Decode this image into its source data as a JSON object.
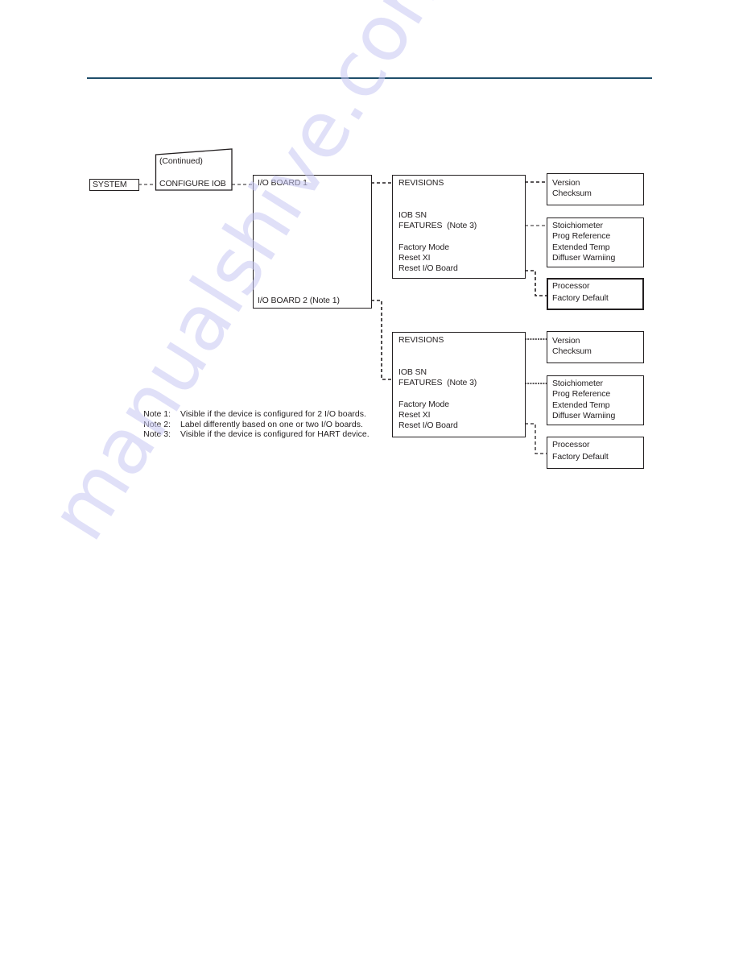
{
  "header": {
    "rule_color": "#1f4e6b"
  },
  "diagram": {
    "system": {
      "label": "SYSTEM"
    },
    "configure": {
      "continued_label": "(Continued)",
      "label": "CONFIGURE IOB"
    },
    "io_boards": {
      "board1_label": "I/O BOARD 1",
      "board2_label": "I/O BOARD 2 (Note 1)"
    },
    "board1": {
      "menu": {
        "revisions": "REVISIONS",
        "iob_sn": "IOB SN",
        "features": "FEATURES",
        "features_note": "(Note 3)",
        "factory_mode": "Factory Mode",
        "reset_xi": "Reset XI",
        "reset_io_board": "Reset I/O Board"
      },
      "revisions_items": [
        "Version",
        "Checksum"
      ],
      "features_items": [
        "Stoichiometer",
        "Prog Reference",
        "Extended Temp",
        "Diffuser Warniing"
      ],
      "reset_items": [
        "Processor",
        "Factory Default"
      ]
    },
    "board2": {
      "menu": {
        "revisions": "REVISIONS",
        "iob_sn": "IOB SN",
        "features": "FEATURES",
        "features_note": "(Note 3)",
        "factory_mode": "Factory Mode",
        "reset_xi": "Reset XI",
        "reset_io_board": "Reset I/O Board"
      },
      "revisions_items": [
        "Version",
        "Checksum"
      ],
      "features_items": [
        "Stoichiometer",
        "Prog Reference",
        "Extended Temp",
        "Diffuser Warniing"
      ],
      "reset_items": [
        "Processor",
        "Factory Default"
      ]
    }
  },
  "notes": [
    {
      "id": "Note 1:",
      "text": "Visible if the device is configured for 2 I/O boards."
    },
    {
      "id": "Note 2:",
      "text": "Label differently based on one or two I/O boards."
    },
    {
      "id": "Note 3:",
      "text": "Visible if the device is configured for HART device."
    }
  ],
  "watermark": {
    "text": "manualshive.com"
  }
}
